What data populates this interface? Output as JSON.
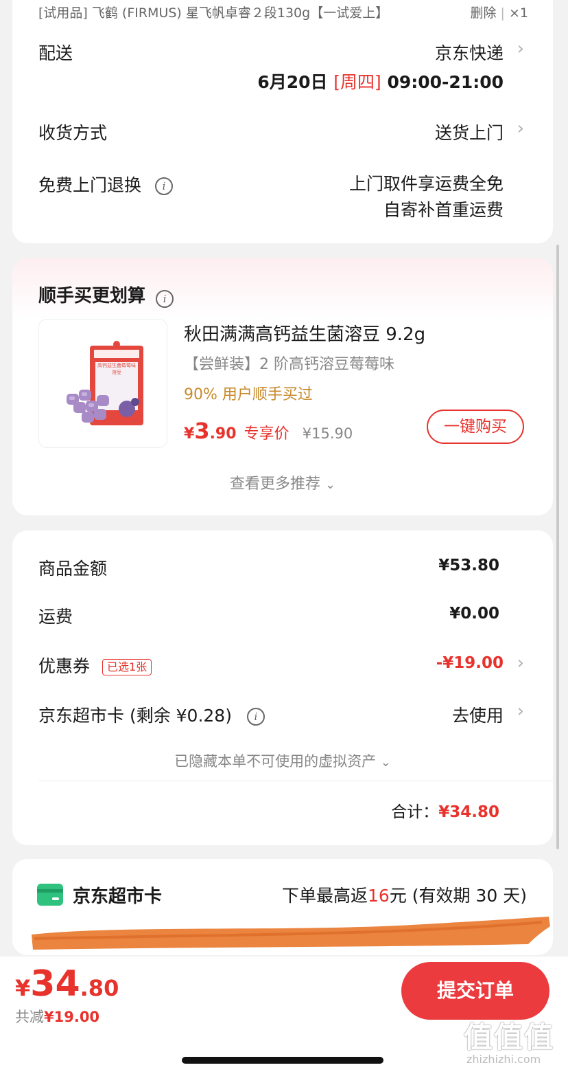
{
  "top_item": {
    "tag": "[试用品]",
    "title": "飞鹤 (FIRMUS) 星飞帆卓睿２段130g【一试爱上】",
    "delete_label": "删除",
    "separator": "|",
    "quantity": "×1"
  },
  "delivery": {
    "label": "配送",
    "carrier": "京东快递",
    "date": "6月20日",
    "weekday": "[周四]",
    "time_window": "09:00-21:00",
    "receive_label": "收货方式",
    "receive_value": "送货上门",
    "return_label": "免费上门退换",
    "return_line1": "上门取件享运费全免",
    "return_line2": "自寄补首重运费"
  },
  "recommend": {
    "section_title": "顺手买更划算",
    "product_title": "秋田满满高钙益生菌溶豆 9.2g",
    "product_spec": "【尝鲜装】2 阶高钙溶豆莓莓味",
    "social_proof": "90% 用户顺手买过",
    "currency": "¥",
    "price_int": "3",
    "price_dec": ".90",
    "price_tag": "专享价",
    "original_price": "¥15.90",
    "buy_button": "一键购买",
    "more_label": "查看更多推荐",
    "box_text": "高钙益生菌莓莓味溶豆"
  },
  "summary": {
    "goods_label": "商品金额",
    "goods_value": "¥53.80",
    "shipping_label": "运费",
    "shipping_value": "¥0.00",
    "coupon_label": "优惠券",
    "coupon_badge": "已选1张",
    "coupon_value": "-¥19.00",
    "card_label": "京东超市卡 (剩余 ¥0.28)",
    "card_value": "去使用",
    "hidden_assets": "已隐藏本单不可使用的虚拟资产",
    "total_label": "合计：",
    "total_value": "¥34.80"
  },
  "supermarket_card": {
    "title": "京东超市卡",
    "desc_prefix": "下单最高返",
    "desc_amount": "16",
    "desc_suffix": "元 (有效期 30 天)"
  },
  "bottom_bar": {
    "currency": "¥",
    "price_int": "34",
    "price_dec": ".80",
    "discount_label": "共减",
    "discount_value": "¥19.00",
    "submit_button": "提交订单"
  },
  "watermark": "值值值",
  "watermark_url": "zhizhizhi.com",
  "colors": {
    "accent_red": "#e8322c",
    "gold": "#c8892a",
    "green_icon": "#2ec27e",
    "scribble": "#e8792f"
  }
}
